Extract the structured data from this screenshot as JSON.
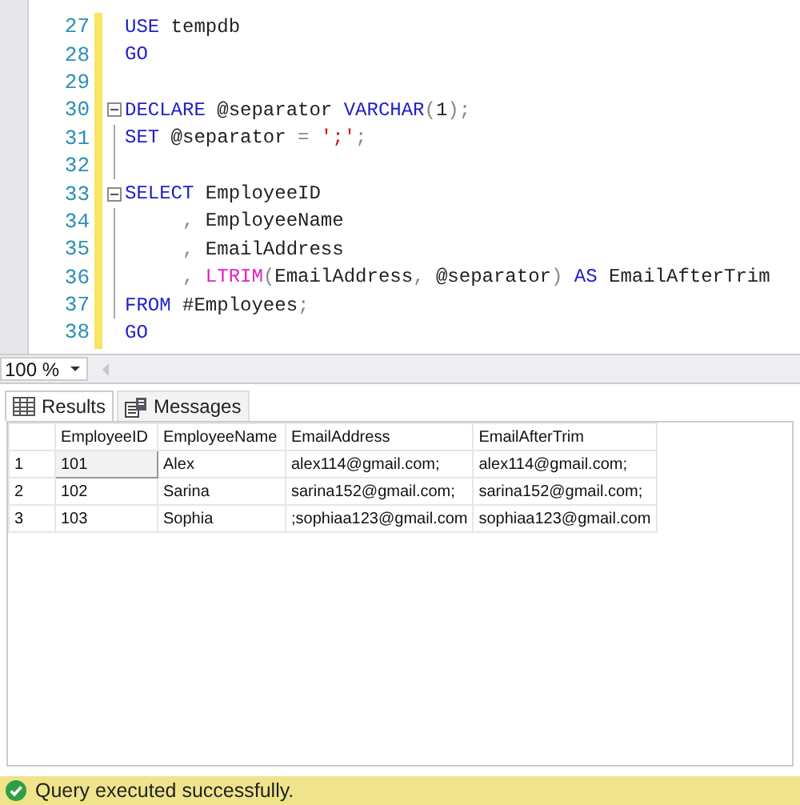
{
  "editor": {
    "lines": [
      {
        "number": "27",
        "fold": false,
        "in_block": false,
        "tokens": [
          {
            "kind": "keyword",
            "text": "USE"
          },
          {
            "kind": "plain",
            "text": " tempdb"
          }
        ]
      },
      {
        "number": "28",
        "fold": false,
        "in_block": false,
        "tokens": [
          {
            "kind": "keyword",
            "text": "GO"
          }
        ]
      },
      {
        "number": "29",
        "fold": false,
        "in_block": false
      },
      {
        "number": "30",
        "fold": true,
        "in_block": false,
        "tokens": [
          {
            "kind": "keyword",
            "text": "DECLARE"
          },
          {
            "kind": "plain",
            "text": " @separator"
          },
          {
            "kind": "keyword",
            "text": " VARCHAR"
          },
          {
            "kind": "gray",
            "text": "("
          },
          {
            "kind": "plain",
            "text": "1"
          },
          {
            "kind": "gray",
            "text": ");"
          }
        ]
      },
      {
        "number": "31",
        "fold": false,
        "in_block": true,
        "tokens": [
          {
            "kind": "keyword",
            "text": "SET"
          },
          {
            "kind": "plain",
            "text": " @separator"
          },
          {
            "kind": "gray",
            "text": " ="
          },
          {
            "kind": "string",
            "text": " ';'"
          },
          {
            "kind": "gray",
            "text": ";"
          }
        ]
      },
      {
        "number": "32",
        "fold": false,
        "in_block": true
      },
      {
        "number": "33",
        "fold": true,
        "in_block": false,
        "tokens": [
          {
            "kind": "keyword",
            "text": "SELECT"
          },
          {
            "kind": "plain",
            "text": " EmployeeID"
          }
        ]
      },
      {
        "number": "34",
        "fold": false,
        "in_block": true,
        "tokens": [
          {
            "kind": "gray",
            "text": "     ,"
          },
          {
            "kind": "plain",
            "text": " EmployeeName"
          }
        ]
      },
      {
        "number": "35",
        "fold": false,
        "in_block": true,
        "tokens": [
          {
            "kind": "gray",
            "text": "     ,"
          },
          {
            "kind": "plain",
            "text": " EmailAddress"
          }
        ]
      },
      {
        "number": "36",
        "fold": false,
        "in_block": true,
        "tokens": [
          {
            "kind": "gray",
            "text": "     ,"
          },
          {
            "kind": "function",
            "text": " LTRIM"
          },
          {
            "kind": "gray",
            "text": "("
          },
          {
            "kind": "plain",
            "text": "EmailAddress"
          },
          {
            "kind": "gray",
            "text": ","
          },
          {
            "kind": "plain",
            "text": " @separator"
          },
          {
            "kind": "gray",
            "text": ")"
          },
          {
            "kind": "keyword",
            "text": " AS"
          },
          {
            "kind": "plain",
            "text": " EmailAfterTrim"
          }
        ]
      },
      {
        "number": "37",
        "fold": false,
        "in_block": true,
        "tokens": [
          {
            "kind": "keyword",
            "text": "FROM"
          },
          {
            "kind": "plain",
            "text": " #Employees"
          },
          {
            "kind": "gray",
            "text": ";"
          }
        ]
      },
      {
        "number": "38",
        "fold": false,
        "in_block": false,
        "tokens": [
          {
            "kind": "keyword",
            "text": "GO"
          }
        ]
      }
    ]
  },
  "zoom": "100 %",
  "tabs": [
    {
      "label": "Results",
      "selected": true
    },
    {
      "label": "Messages",
      "selected": false
    }
  ],
  "table": {
    "columns": [
      "EmployeeID",
      "EmployeeName",
      "EmailAddress",
      "EmailAfterTrim"
    ],
    "rows": [
      {
        "number": "1",
        "cells": [
          "101",
          "Alex",
          "alex114@gmail.com;",
          "alex114@gmail.com;"
        ]
      },
      {
        "number": "2",
        "cells": [
          "102",
          "Sarina",
          "sarina152@gmail.com;",
          "sarina152@gmail.com;"
        ]
      },
      {
        "number": "3",
        "cells": [
          "103",
          "Sophia",
          ";sophiaa123@gmail.com",
          "sophiaa123@gmail.com"
        ]
      }
    ]
  },
  "status_bar": {
    "text": "Query executed successfully."
  }
}
